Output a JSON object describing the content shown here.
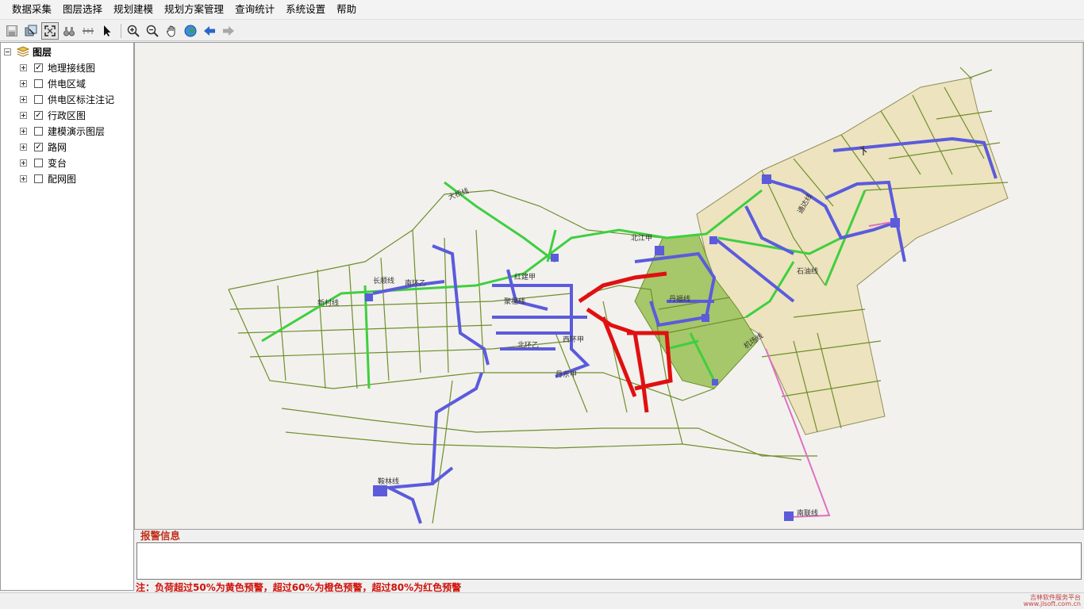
{
  "menu": [
    "数据采集",
    "图层选择",
    "规划建模",
    "规划方案管理",
    "查询统计",
    "系统设置",
    "帮助"
  ],
  "toolbar": {
    "icons": [
      "save-icon",
      "select-layer-icon",
      "full-extent-icon",
      "binoculars-icon",
      "measure-icon",
      "pointer-icon",
      "zoom-in-icon",
      "zoom-out-icon",
      "pan-hand-icon",
      "globe-icon",
      "back-arrow-icon",
      "forward-arrow-icon"
    ]
  },
  "layers": {
    "root_label": "图层",
    "items": [
      {
        "label": "地理接线图",
        "checked": true
      },
      {
        "label": "供电区域",
        "checked": false
      },
      {
        "label": "供电区标注注记",
        "checked": false
      },
      {
        "label": "行政区图",
        "checked": true
      },
      {
        "label": "建模演示图层",
        "checked": false
      },
      {
        "label": "路网",
        "checked": true
      },
      {
        "label": "变台",
        "checked": false
      },
      {
        "label": "配网图",
        "checked": false
      }
    ]
  },
  "map": {
    "labels": [
      "北江甲",
      "南联线",
      "鞍林线",
      "红建甲",
      "西环甲",
      "丹东甲",
      "聚福线",
      "机场线",
      "长顺线",
      "新村线",
      "丹福线",
      "石油线",
      "通达线",
      "南环乙",
      "北环乙",
      "大桥线"
    ],
    "colors": {
      "road": "#6f8f2a",
      "line_blue": "#5b5bdc",
      "line_green": "#3fcf3f",
      "line_red": "#e01010",
      "line_pink": "#e070c0",
      "zone_tan": "#ede3bf",
      "zone_green": "#a6c76a"
    }
  },
  "alarm": {
    "title": "报警信息",
    "note": "注：负荷超过50%为黄色预警，超过60%为橙色预警，超过80%为红色预警"
  },
  "watermark": {
    "line1": "吉林软件服务平台",
    "line2": "www.jlsoft.com.cn"
  }
}
